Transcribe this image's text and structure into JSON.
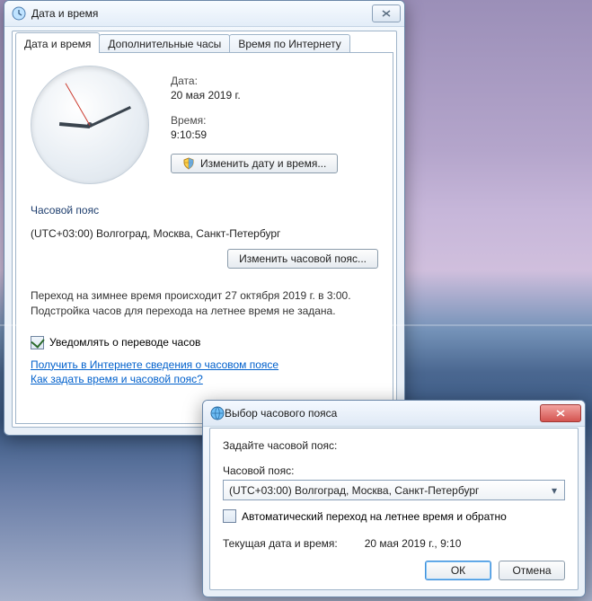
{
  "main": {
    "title": "Дата и время",
    "tabs": [
      "Дата и время",
      "Дополнительные часы",
      "Время по Интернету"
    ],
    "date_label": "Дата:",
    "date_value": "20 мая 2019 г.",
    "time_label": "Время:",
    "time_value": "9:10:59",
    "change_datetime_btn": "Изменить дату и время...",
    "tz_heading": "Часовой пояс",
    "tz_value": "(UTC+03:00) Волгоград, Москва, Санкт-Петербург",
    "change_tz_btn": "Изменить часовой пояс...",
    "dst_info": "Переход на зимнее время происходит 27 октября 2019 г. в 3:00.\nПодстройка часов для перехода на летнее время не задана.",
    "notify_cb": "Уведомлять о переводе часов",
    "link1": "Получить в Интернете сведения о часовом поясе",
    "link2": "Как задать время и часовой пояс?"
  },
  "tzdlg": {
    "title": "Выбор часового пояса",
    "prompt": "Задайте часовой пояс:",
    "label": "Часовой пояс:",
    "selected": "(UTC+03:00) Волгоград, Москва, Санкт-Петербург",
    "auto_dst_cb": "Автоматический переход на летнее время и обратно",
    "current_label": "Текущая дата и время:",
    "current_value": "20 мая 2019 г., 9:10",
    "ok": "ОК",
    "cancel": "Отмена"
  }
}
